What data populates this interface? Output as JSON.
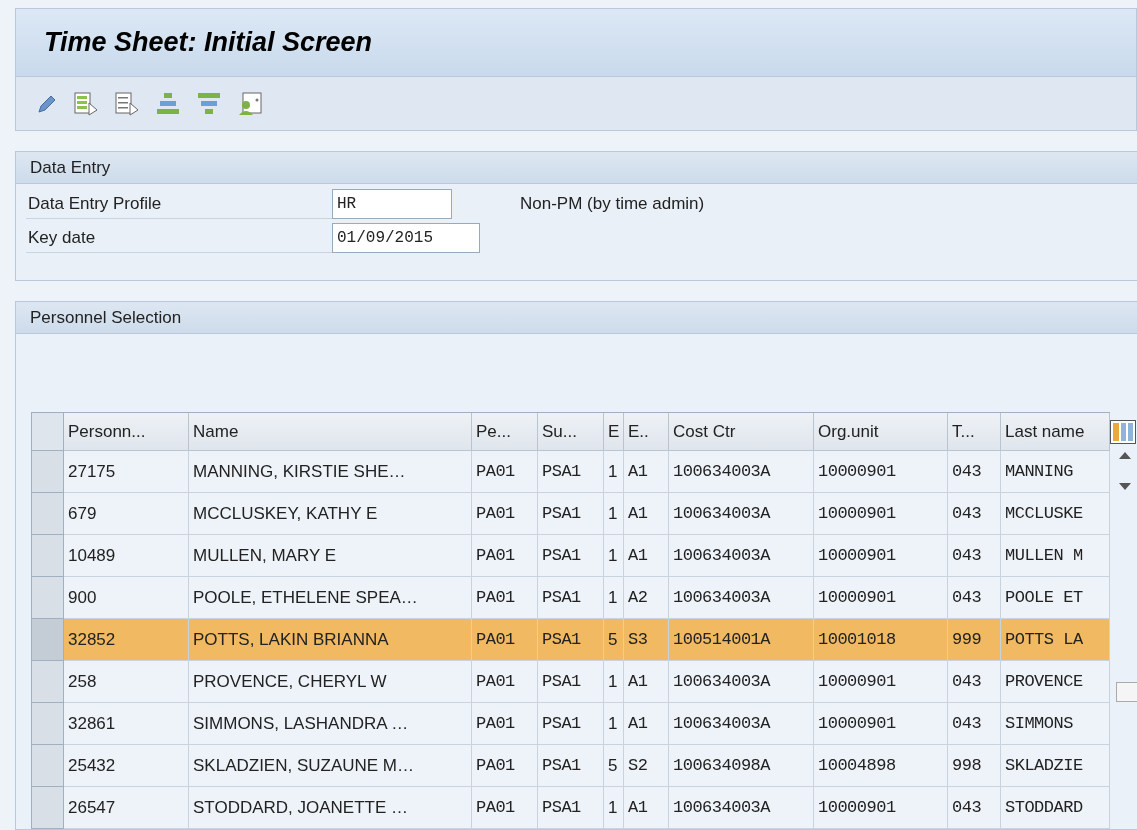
{
  "window": {
    "title": "Time Sheet: Initial Screen"
  },
  "toolbar": {
    "buttons": [
      {
        "kind": "pencil"
      },
      {
        "kind": "list-green"
      },
      {
        "kind": "list-plain"
      },
      {
        "kind": "stack"
      },
      {
        "kind": "filter"
      },
      {
        "kind": "person"
      }
    ]
  },
  "data_entry": {
    "title": "Data Entry",
    "fields": [
      {
        "label": "Data Entry Profile",
        "value": "HR",
        "description": "Non-PM (by time admin)"
      },
      {
        "label": "Key date",
        "value": "01/09/2015"
      }
    ]
  },
  "personnel_selection": {
    "title": "Personnel Selection",
    "table": {
      "columns": [
        "Personn...",
        "Name",
        "Pe...",
        "Su...",
        "E",
        "E..",
        "Cost Ctr",
        "Org.unit",
        "T...",
        "Last name"
      ],
      "rows": [
        {
          "selected": false,
          "cells": [
            "27175",
            "MANNING, KIRSTIE SHE…",
            "PA01",
            "PSA1",
            "1",
            "A1",
            "100634003A",
            "10000901",
            "043",
            "MANNING"
          ]
        },
        {
          "selected": false,
          "cells": [
            "679",
            "MCCLUSKEY, KATHY E",
            "PA01",
            "PSA1",
            "1",
            "A1",
            "100634003A",
            "10000901",
            "043",
            "MCCLUSKE"
          ]
        },
        {
          "selected": false,
          "cells": [
            "10489",
            "MULLEN, MARY E",
            "PA01",
            "PSA1",
            "1",
            "A1",
            "100634003A",
            "10000901",
            "043",
            "MULLEN M"
          ]
        },
        {
          "selected": false,
          "cells": [
            "900",
            "POOLE, ETHELENE SPEA…",
            "PA01",
            "PSA1",
            "1",
            "A2",
            "100634003A",
            "10000901",
            "043",
            "POOLE ET"
          ]
        },
        {
          "selected": true,
          "cells": [
            "32852",
            "POTTS, LAKIN BRIANNA",
            "PA01",
            "PSA1",
            "5",
            "S3",
            "100514001A",
            "10001018",
            "999",
            "POTTS LA"
          ]
        },
        {
          "selected": false,
          "cells": [
            "258",
            "PROVENCE, CHERYL W",
            "PA01",
            "PSA1",
            "1",
            "A1",
            "100634003A",
            "10000901",
            "043",
            "PROVENCE"
          ]
        },
        {
          "selected": false,
          "cells": [
            "32861",
            "SIMMONS, LASHANDRA …",
            "PA01",
            "PSA1",
            "1",
            "A1",
            "100634003A",
            "10000901",
            "043",
            "SIMMONS"
          ]
        },
        {
          "selected": false,
          "cells": [
            "25432",
            "SKLADZIEN, SUZAUNE M…",
            "PA01",
            "PSA1",
            "5",
            "S2",
            "100634098A",
            "10004898",
            "998",
            "SKLADZIE"
          ]
        },
        {
          "selected": false,
          "cells": [
            "26547",
            "STODDARD, JOANETTE …",
            "PA01",
            "PSA1",
            "1",
            "A1",
            "100634003A",
            "10000901",
            "043",
            "STODDARD"
          ]
        }
      ]
    }
  }
}
